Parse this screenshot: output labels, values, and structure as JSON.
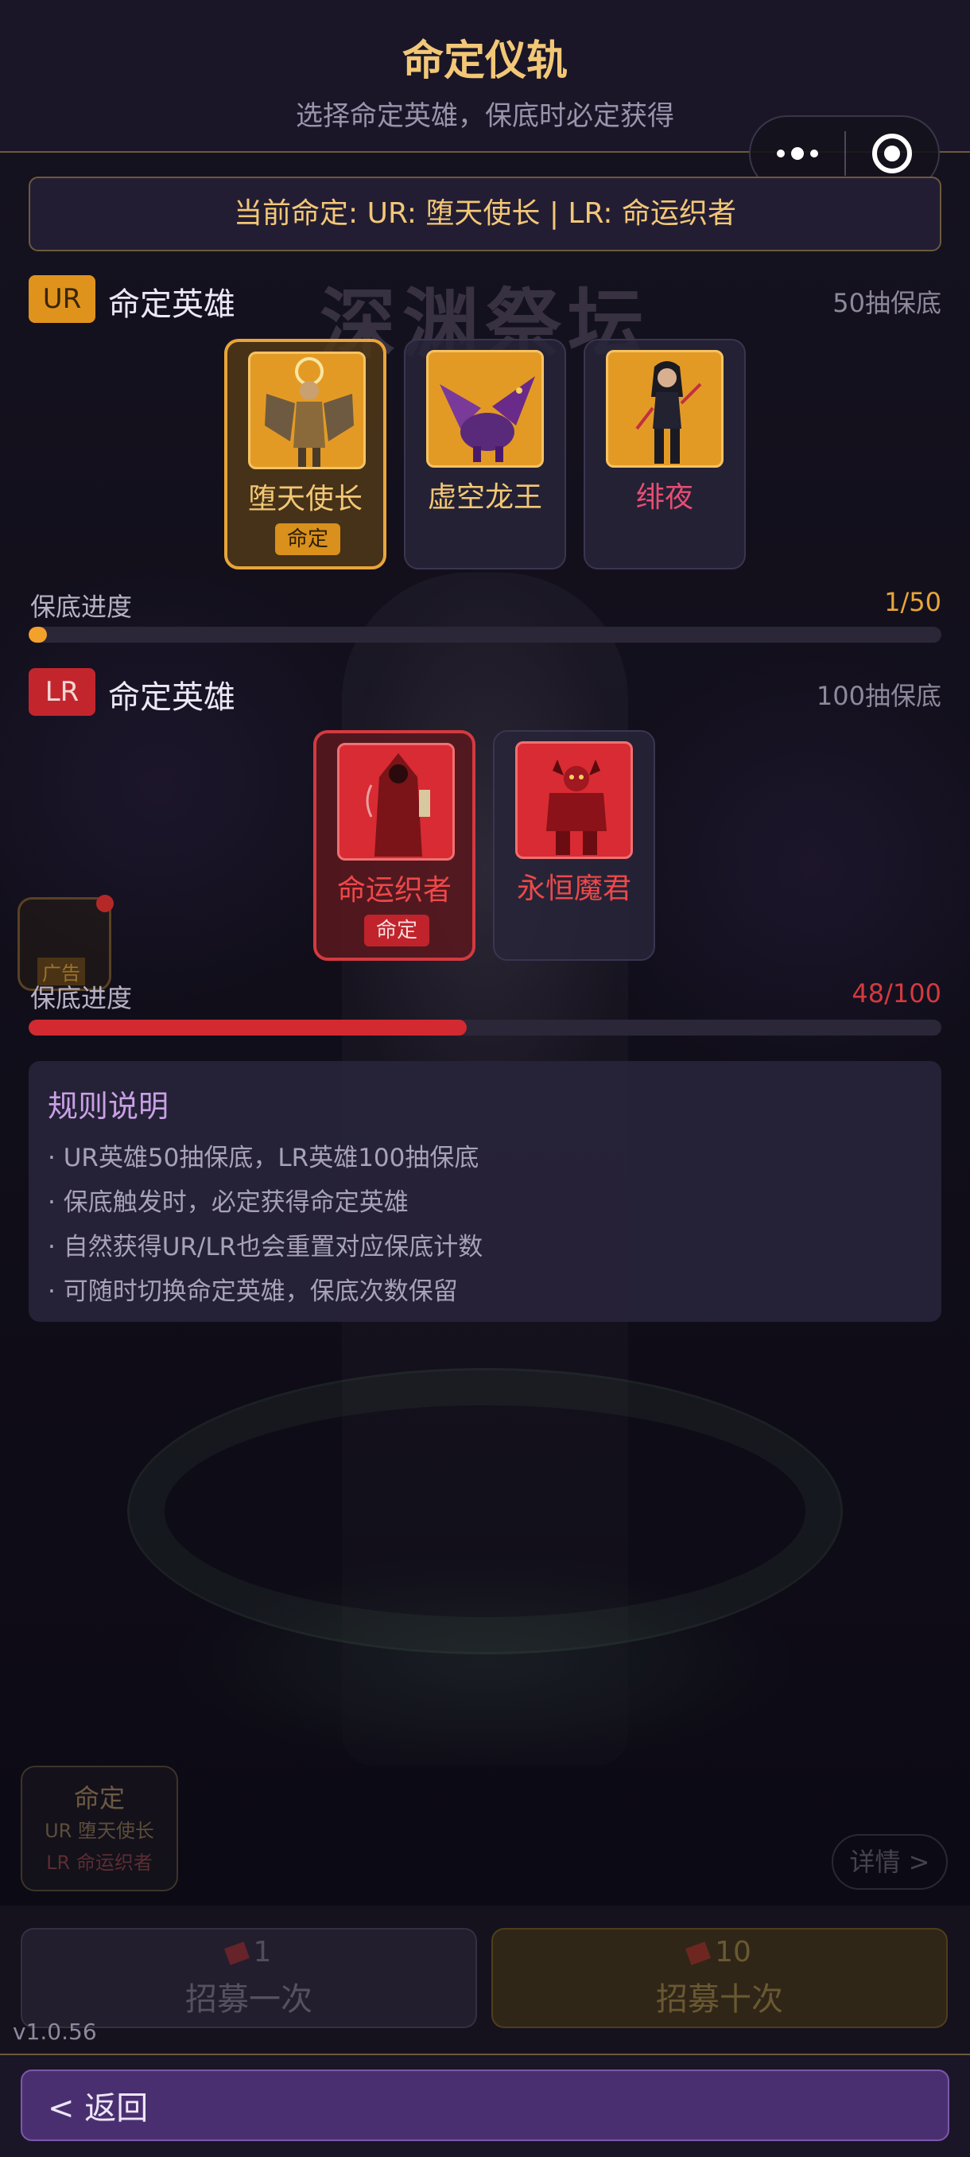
{
  "header": {
    "title": "命定仪轨",
    "subtitle": "选择命定英雄，保底时必定获得"
  },
  "background": {
    "title": "深渊祭坛",
    "ad_label": "广告",
    "fate_panel": {
      "title": "命定",
      "ur_line": "UR 堕天使长",
      "lr_line": "LR 命运织者"
    },
    "detail_label": "详情 >",
    "pull_one": {
      "cost": "1",
      "label": "招募一次"
    },
    "pull_ten": {
      "cost": "10",
      "label": "招募十次"
    }
  },
  "current_banner": "当前命定: UR: 堕天使长 | LR: 命运织者",
  "ur": {
    "tag": "UR",
    "title": "命定英雄",
    "pity": "50抽保底",
    "heroes": [
      {
        "name": "堕天使长",
        "selected": true,
        "badge": "命定",
        "icon": "fallen-angel-portrait"
      },
      {
        "name": "虚空龙王",
        "selected": false,
        "icon": "void-dragon-portrait"
      },
      {
        "name": "绯夜",
        "selected": false,
        "icon": "crimson-night-portrait"
      }
    ],
    "progress_label": "保底进度",
    "progress_text": "1/50",
    "progress_current": 1,
    "progress_max": 50
  },
  "lr": {
    "tag": "LR",
    "title": "命定英雄",
    "pity": "100抽保底",
    "heroes": [
      {
        "name": "命运织者",
        "selected": true,
        "badge": "命定",
        "icon": "fate-weaver-portrait"
      },
      {
        "name": "永恒魔君",
        "selected": false,
        "icon": "eternal-demon-lord-portrait"
      }
    ],
    "progress_label": "保底进度",
    "progress_text": "48/100",
    "progress_current": 48,
    "progress_max": 100
  },
  "rules": {
    "title": "规则说明",
    "items": [
      "· UR英雄50抽保底，LR英雄100抽保底",
      "· 保底触发时，必定获得命定英雄",
      "· 自然获得UR/LR也会重置对应保底计数",
      "· 可随时切换命定英雄，保底次数保留"
    ]
  },
  "version": "v1.0.56",
  "footer": {
    "back_label": "< 返回"
  },
  "colors": {
    "gold": "#f2c776",
    "ur": "#e0931c",
    "lr": "#c2262c",
    "back": "#4a2f70"
  }
}
